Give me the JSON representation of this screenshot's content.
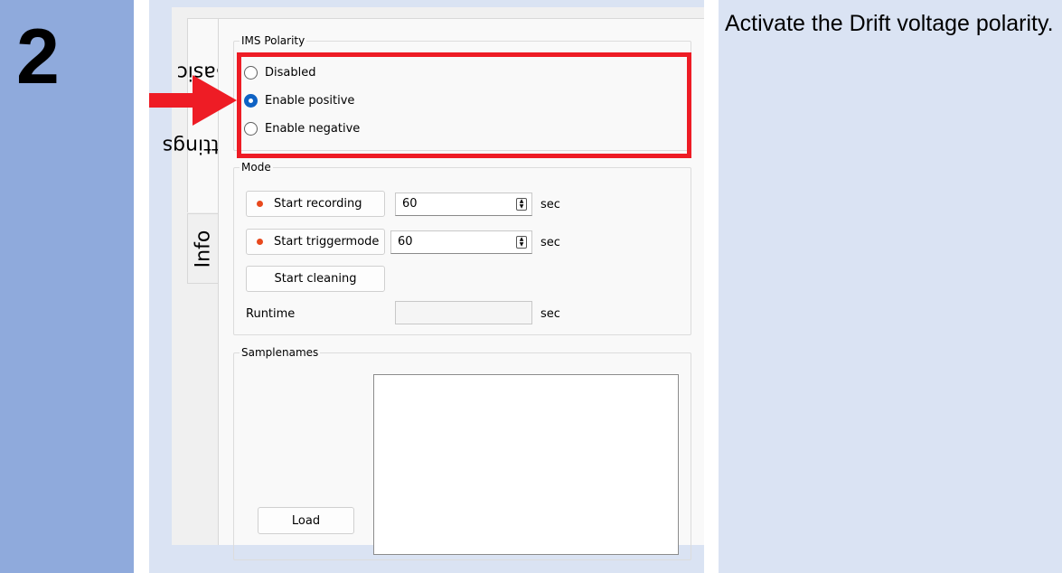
{
  "step": {
    "number": "2"
  },
  "instruction": {
    "text": "Activate the Drift voltage polarity."
  },
  "tabs": [
    {
      "label": "Basic"
    },
    {
      "label": "Settings"
    },
    {
      "label": "Info"
    }
  ],
  "ims_polarity": {
    "title": "IMS Polarity",
    "options": [
      {
        "label": "Disabled",
        "selected": false
      },
      {
        "label": "Enable positive",
        "selected": true
      },
      {
        "label": "Enable negative",
        "selected": false
      }
    ]
  },
  "mode": {
    "title": "Mode",
    "start_recording": {
      "label": "Start recording",
      "value": "60",
      "unit": "sec"
    },
    "start_triggermode": {
      "label": "Start triggermode",
      "value": "60",
      "unit": "sec"
    },
    "start_cleaning": {
      "label": "Start cleaning"
    },
    "runtime": {
      "label": "Runtime",
      "value": "",
      "unit": "sec"
    }
  },
  "samplenames": {
    "title": "Samplenames",
    "load_label": "Load"
  },
  "colors": {
    "step_column": "#8faadc",
    "panel_background": "#dae3f3",
    "highlight": "#ee1c25",
    "arrow": "#ee1c25",
    "radio_selected": "#0f62c4",
    "record_dot": "#e8491d"
  }
}
